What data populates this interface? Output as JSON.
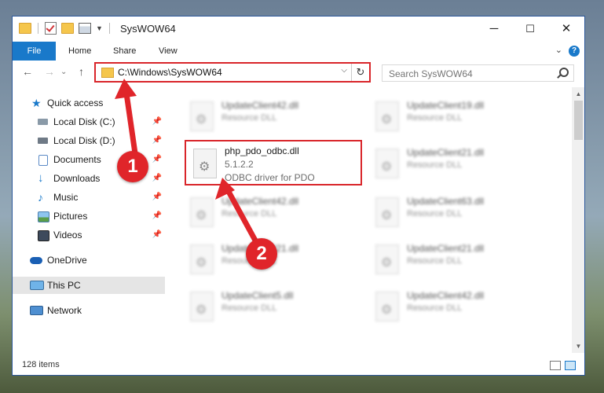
{
  "window": {
    "title": "SysWOW64",
    "controls": {
      "minimize": "─",
      "maximize": "☐",
      "close": "✕"
    }
  },
  "ribbon": {
    "tabs": [
      "File",
      "Home",
      "Share",
      "View"
    ],
    "help": "?"
  },
  "navigation": {
    "back": "←",
    "forward": "→",
    "up": "↑",
    "recent": "⌄",
    "address": "C:\\Windows\\SysWOW64",
    "refresh": "↻",
    "search_placeholder": "Search SysWOW64"
  },
  "nav_pane": {
    "items": [
      {
        "label": "Quick access",
        "icon": "star-icon",
        "pinned": false
      },
      {
        "label": "Local Disk (C:)",
        "icon": "drive-icon",
        "pinned": true
      },
      {
        "label": "Local Disk (D:)",
        "icon": "drive-icon",
        "pinned": true
      },
      {
        "label": "Documents",
        "icon": "documents-icon",
        "pinned": true
      },
      {
        "label": "Downloads",
        "icon": "download-icon",
        "pinned": true
      },
      {
        "label": "Music",
        "icon": "music-icon",
        "pinned": true
      },
      {
        "label": "Pictures",
        "icon": "pictures-icon",
        "pinned": true
      },
      {
        "label": "Videos",
        "icon": "videos-icon",
        "pinned": true
      },
      {
        "label": "OneDrive",
        "icon": "cloud-icon",
        "pinned": false
      },
      {
        "label": "This PC",
        "icon": "computer-icon",
        "pinned": false,
        "selected": true
      },
      {
        "label": "Network",
        "icon": "network-icon",
        "pinned": false
      }
    ],
    "pin_glyph": "📌"
  },
  "files": {
    "highlighted": {
      "name": "php_pdo_odbc.dll",
      "version": "5.1.2.2",
      "description": "ODBC driver for PDO"
    },
    "left_column": [
      {
        "name": "UpdateClient42.dll",
        "description": "Resource DLL"
      },
      {
        "name": "UpdateClient42.dll",
        "description": "Resource DLL"
      },
      {
        "name": "UpdateClient21.dll",
        "description": "Resource DLL"
      },
      {
        "name": "UpdateClient5.dll",
        "description": "Resource DLL"
      }
    ],
    "right_column": [
      {
        "name": "UpdateClient19.dll",
        "description": "Resource DLL"
      },
      {
        "name": "UpdateClient21.dll",
        "description": "Resource DLL"
      },
      {
        "name": "UpdateClient63.dll",
        "description": "Resource DLL"
      },
      {
        "name": "UpdateClient21.dll",
        "description": "Resource DLL"
      },
      {
        "name": "UpdateClient42.dll",
        "description": "Resource DLL"
      }
    ]
  },
  "status": {
    "item_count": "128 items"
  },
  "callouts": {
    "step1": "1",
    "step2": "2"
  },
  "colors": {
    "accent": "#1979ca",
    "highlight": "#d9252a",
    "callout": "#e0252a"
  }
}
